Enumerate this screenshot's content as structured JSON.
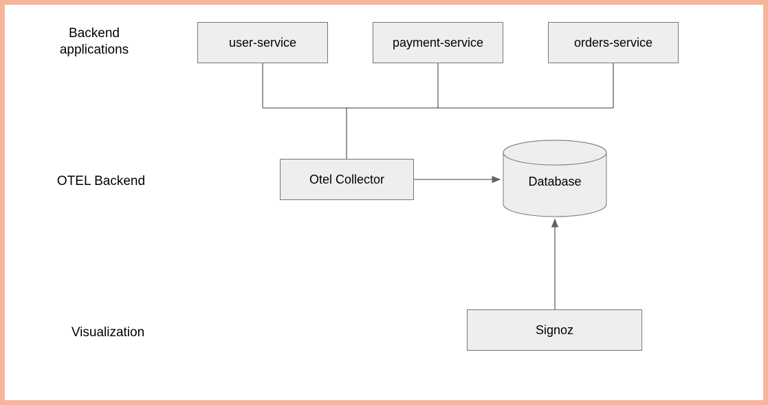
{
  "rows": {
    "backend_apps": {
      "label": "Backend\napplications"
    },
    "otel_backend": {
      "label": "OTEL Backend"
    },
    "visualization": {
      "label": "Visualization"
    }
  },
  "nodes": {
    "user_service": {
      "label": "user-service"
    },
    "payment_service": {
      "label": "payment-service"
    },
    "orders_service": {
      "label": "orders-service"
    },
    "otel_collector": {
      "label": "Otel Collector"
    },
    "database": {
      "label": "Database"
    },
    "signoz": {
      "label": "Signoz"
    }
  },
  "colors": {
    "frame_border": "#f7b49d",
    "node_fill": "#eeeeee",
    "node_stroke": "#757575",
    "connector": "#606060"
  }
}
